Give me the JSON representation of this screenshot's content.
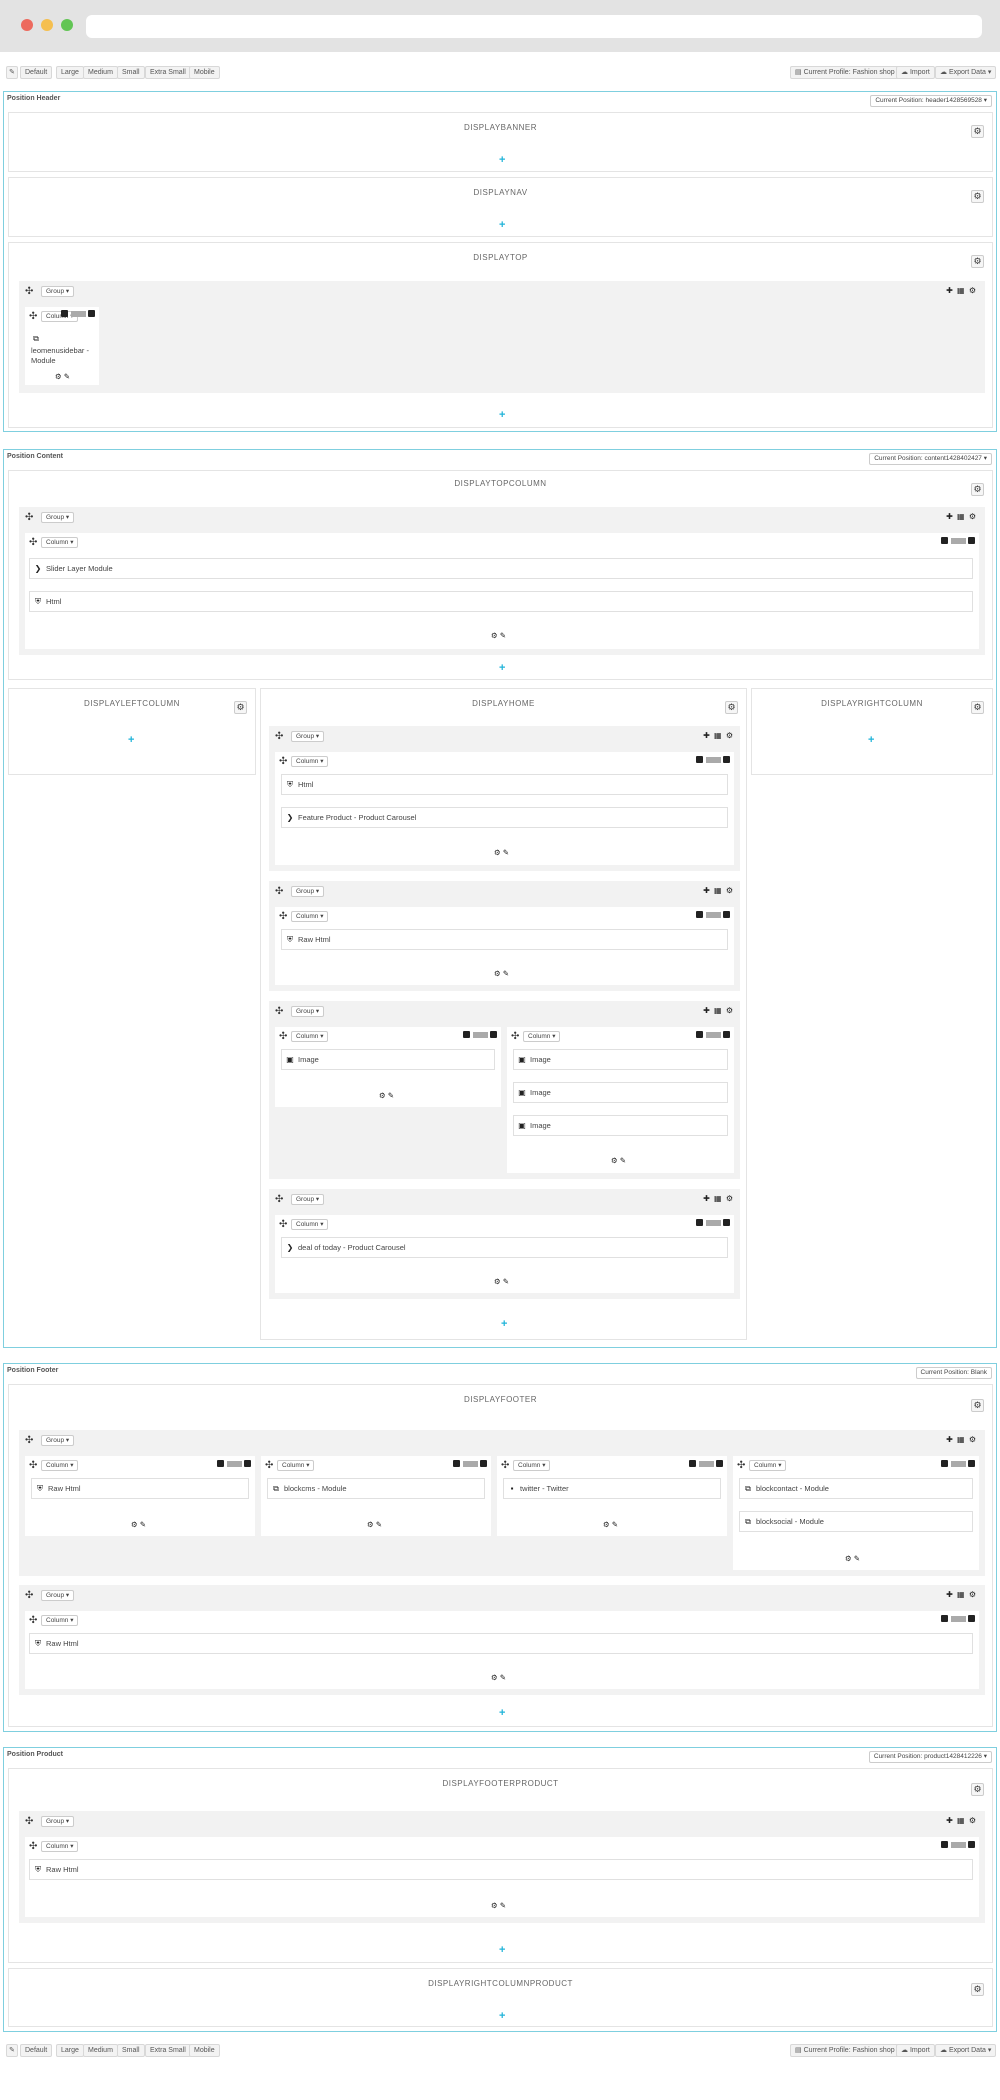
{
  "toolbar": {
    "wrench": "✎",
    "devices": [
      "Default",
      "Large",
      "Medium",
      "Small",
      "Extra Small",
      "Mobile"
    ],
    "profile": "Current Profile: Fashion shop",
    "import": "Import",
    "export": "Export Data ▾"
  },
  "positions": {
    "header": {
      "title": "Position Header",
      "current": "Current Position: header1428569528 ▾"
    },
    "content": {
      "title": "Position Content",
      "current": "Current Position: content1428402427 ▾"
    },
    "footer": {
      "title": "Position Footer",
      "current": "Current Position: Blank"
    },
    "product": {
      "title": "Position Product",
      "current": "Current Position: product1428412226 ▾"
    }
  },
  "hooks": {
    "displaybanner": "DISPLAYBANNER",
    "displaynav": "DISPLAYNAV",
    "displaytop": "DISPLAYTOP",
    "displaytopcolumn": "DISPLAYTOPCOLUMN",
    "displayleftcolumn": "DISPLAYLEFTCOLUMN",
    "displayhome": "DISPLAYHOME",
    "displayrightcolumn": "DISPLAYRIGHTCOLUMN",
    "displayfooter": "DISPLAYFOOTER",
    "displayfooterproduct": "DISPLAYFOOTERPRODUCT",
    "displayrightcolumnproduct": "DISPLAYRIGHTCOLUMNPRODUCT"
  },
  "ui": {
    "group": "Group ▾",
    "column": "Column ▾",
    "gear": "⚙",
    "plus": "+",
    "move": "✣",
    "group_icons": "✚ ▦ ⚙",
    "ops": "⚙ ✎"
  },
  "modules": {
    "leomenusidebar": "leomenusidebar - Module",
    "slider": "Slider Layer Module",
    "html": "Html",
    "feature": "Feature Product - Product Carousel",
    "rawhtml": "Raw Html",
    "image": "Image",
    "deal": "deal of today - Product Carousel",
    "blockcms": "blockcms - Module",
    "twitter": "twitter - Twitter",
    "blockcontact": "blockcontact - Module",
    "blocksocial": "blocksocial - Module"
  },
  "icons": {
    "module": "⧉",
    "html": "⛨",
    "chevron": "❯",
    "image": "▣",
    "twitter": "▪"
  }
}
